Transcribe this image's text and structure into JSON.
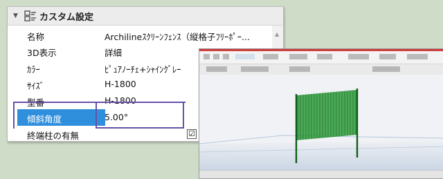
{
  "panel": {
    "title": "カスタム設定",
    "rows": [
      {
        "key": "名称",
        "value": "Archilineｽｸﾘｰﾝﾌｪﾝｽ（縦格子ﾌﾘｰﾎﾟｰ..."
      },
      {
        "key": "3D表示",
        "value": "詳細"
      },
      {
        "key": "ｶﾗｰ",
        "value": "ﾋﾟｭｱﾉｰﾁｪ+ｼｬｲﾝｸﾞﾚｰ"
      },
      {
        "key": "ｻｲｽﾞ",
        "value": "H-1800"
      },
      {
        "key": "型番",
        "value": "H-1800"
      },
      {
        "key": "傾斜角度",
        "value": "5.00°"
      },
      {
        "key": "終端柱の有無",
        "value": "☑"
      }
    ]
  },
  "colors": {
    "selection": "#2f8fdd",
    "highlight_box": "#6650a8",
    "fence": "#1f9a2c"
  },
  "icons": [
    "caret-down-icon",
    "properties-icon",
    "scroll-up-icon",
    "checkbox-checked-icon"
  ]
}
